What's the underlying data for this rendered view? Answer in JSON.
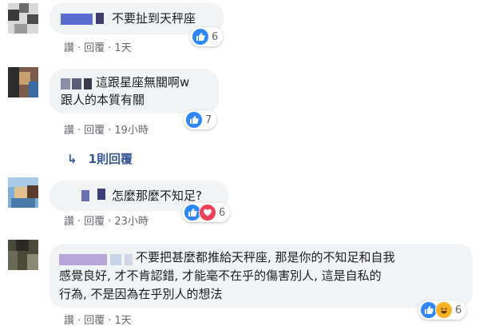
{
  "comments": [
    {
      "text": "不要扯到天秤座",
      "actions": {
        "like": "讚",
        "reply": "回覆",
        "time": "1天"
      },
      "reaction_count": "6"
    },
    {
      "text_line1": "這跟星座無關啊w",
      "text_line2": "跟人的本質有關",
      "actions": {
        "like": "讚",
        "reply": "回覆",
        "time": "19小時"
      },
      "reaction_count": "7"
    },
    {
      "text": "怎麼那麼不知足?",
      "actions": {
        "like": "讚",
        "reply": "回覆",
        "time": "23小時"
      },
      "reaction_count": "6"
    },
    {
      "text_line1": "不要把甚麼都推給天秤座, 那是你的不知足和自我",
      "text_line2": "感覺良好, 才不肯認錯, 才能毫不在乎的傷害別人, 這是自私的",
      "text_line3": "行為, 不是因為在乎別人的想法",
      "actions": {
        "like": "讚",
        "reply": "回覆",
        "time": "1天"
      },
      "reaction_count": "6"
    }
  ],
  "replies_link": {
    "arrow": "↳",
    "label": "1則回覆"
  },
  "icons": [
    "like-icon",
    "love-icon",
    "haha-icon",
    "reply-arrow-icon"
  ],
  "colors": {
    "bubble": "#f2f3f5",
    "link": "#385898",
    "like": "#2d88ff",
    "love": "#f33e58",
    "haha": "#f7b125"
  }
}
